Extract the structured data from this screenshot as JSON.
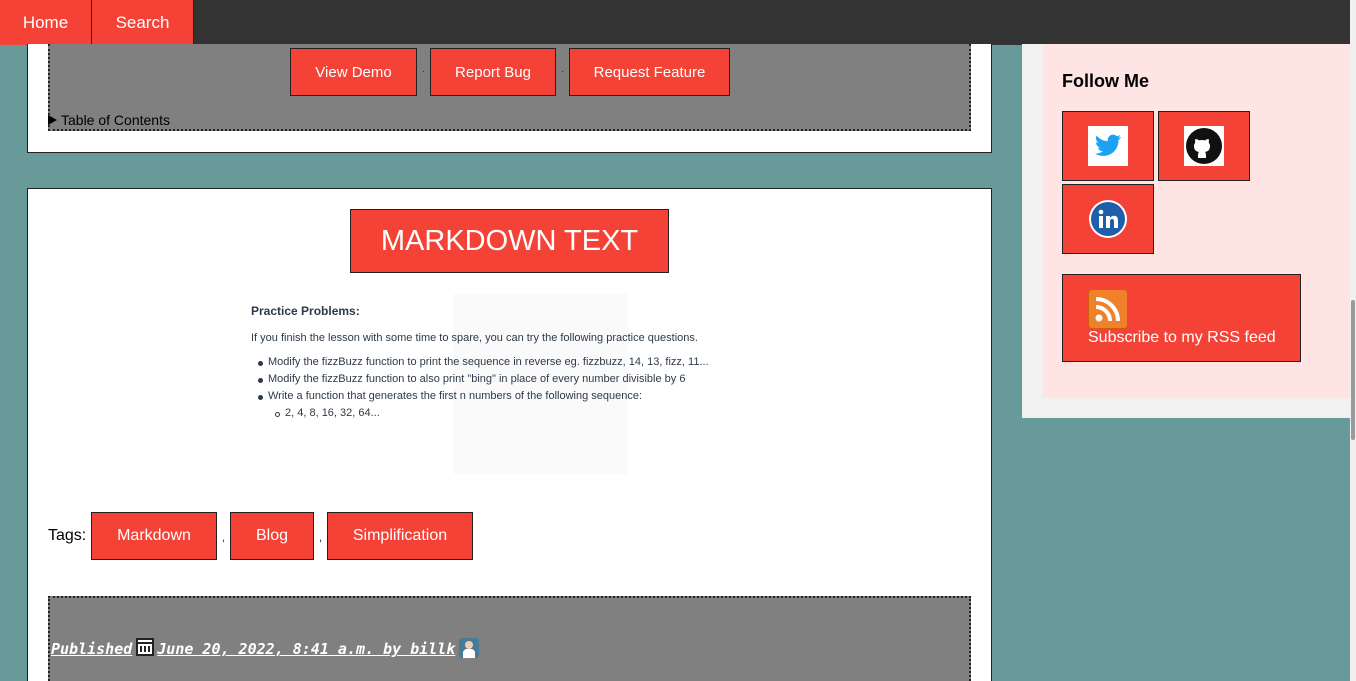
{
  "nav": {
    "home": "Home",
    "search": "Search"
  },
  "project_links": {
    "demo": "View Demo",
    "bug": "Report Bug",
    "feature": "Request Feature",
    "separator": "·"
  },
  "toc": {
    "label": "Table of Contents"
  },
  "post": {
    "title": "MARKDOWN TEXT",
    "image_text": {
      "heading": "Practice Problems:",
      "intro": "If you finish the lesson with some time to spare, you can try the following practice questions.",
      "items": [
        "Modify the fizzBuzz function to print the sequence in reverse eg. fizzbuzz, 14, 13, fizz, 11...",
        "Modify the fizzBuzz function to also print \"bing\" in place of every number divisible by 6",
        "Write a function that generates the first n numbers of the following sequence:"
      ],
      "subitem": "2, 4, 8, 16, 32, 64..."
    },
    "tags_label": "Tags:",
    "tags": [
      "Markdown",
      "Blog",
      "Simplification"
    ],
    "tag_separator": ",",
    "published_prefix": "Published ",
    "published_date": "June 20, 2022, 8:41 a.m. by billk "
  },
  "sidebar": {
    "follow_title": "Follow Me",
    "social": [
      "twitter-icon",
      "github-icon",
      "linkedin-icon"
    ],
    "rss_label": "Subscribe to my RSS feed"
  },
  "colors": {
    "accent": "#f44336",
    "background": "#689a9a",
    "nav": "#333333",
    "sidebar_panel": "#ffe4e4",
    "gray_box": "#808080"
  }
}
